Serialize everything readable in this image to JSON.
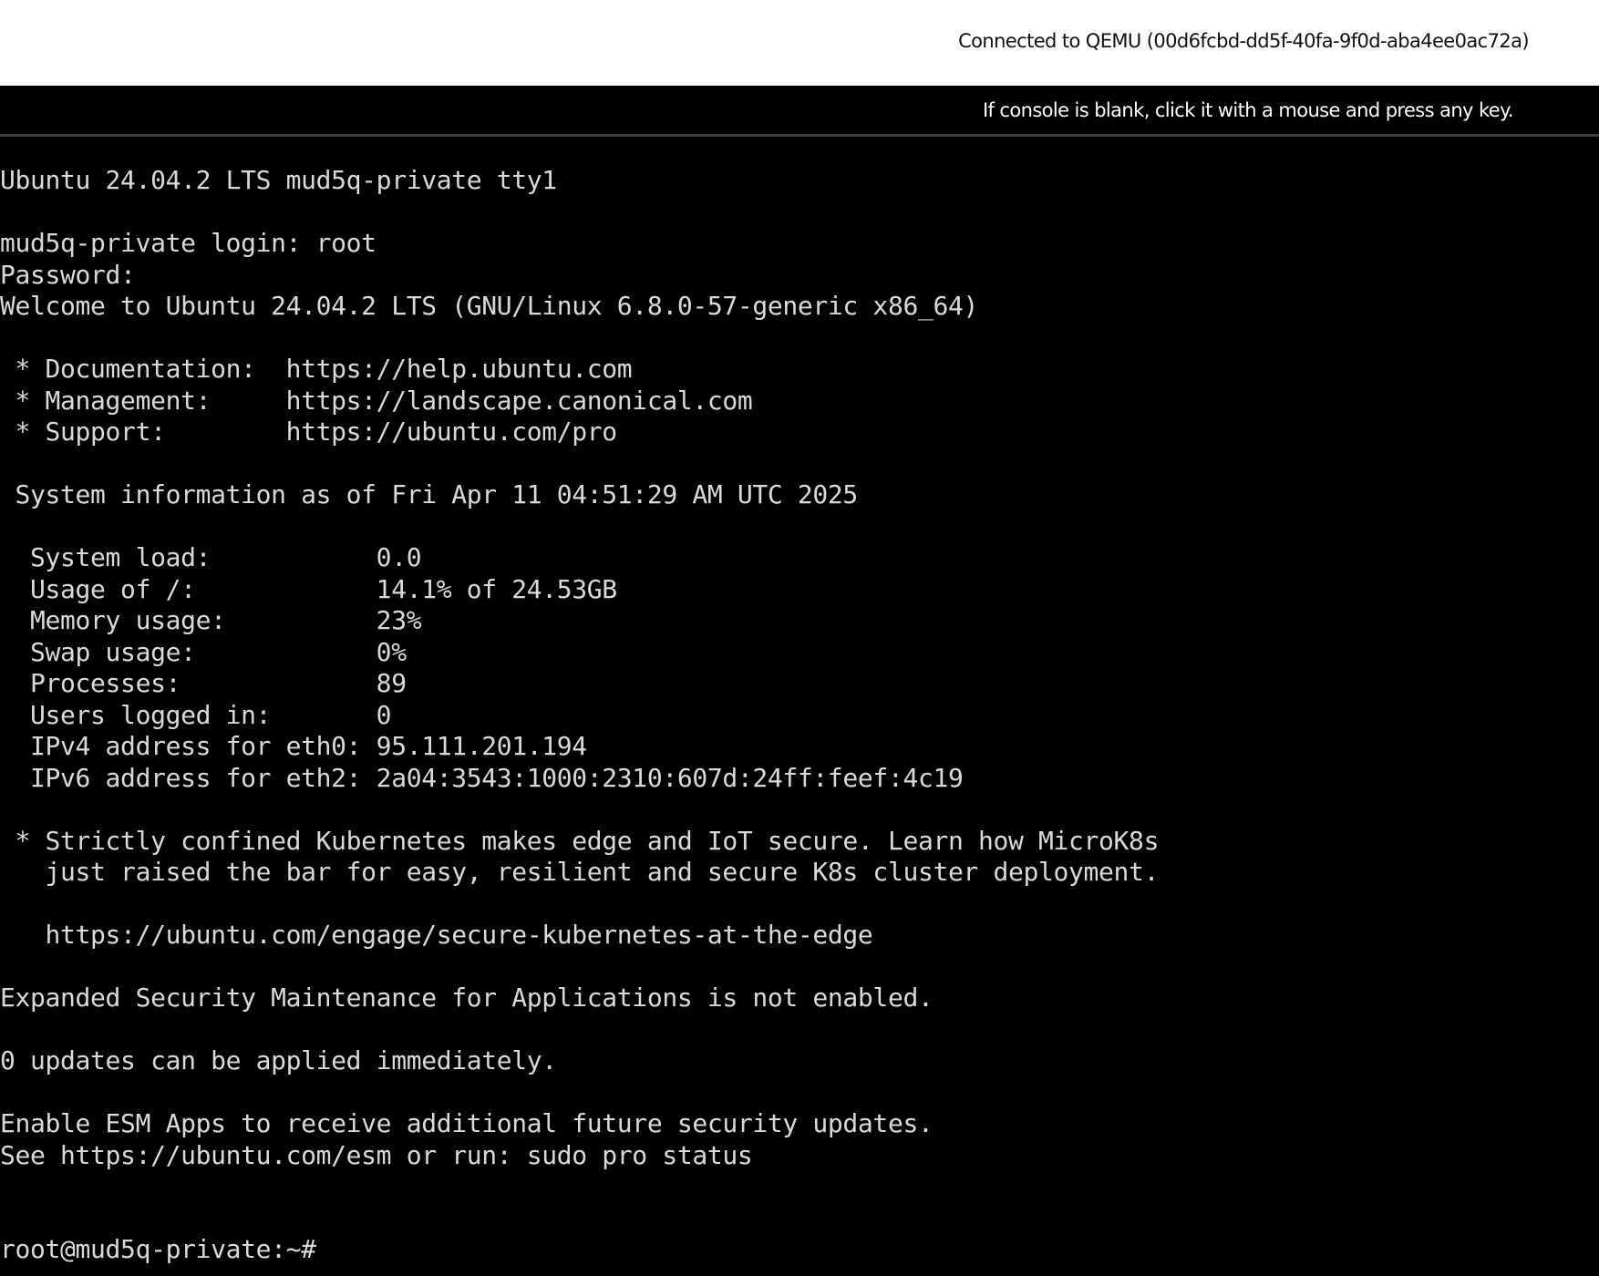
{
  "header": {
    "connection_status": "Connected to QEMU (00d6fcbd-dd5f-40fa-9f0d-aba4ee0ac72a)"
  },
  "console": {
    "hint": "If console is blank, click it with a mouse and press any key.",
    "lines": [
      "Ubuntu 24.04.2 LTS mud5q-private tty1",
      "",
      "mud5q-private login: root",
      "Password:",
      "Welcome to Ubuntu 24.04.2 LTS (GNU/Linux 6.8.0-57-generic x86_64)",
      "",
      " * Documentation:  https://help.ubuntu.com",
      " * Management:     https://landscape.canonical.com",
      " * Support:        https://ubuntu.com/pro",
      "",
      " System information as of Fri Apr 11 04:51:29 AM UTC 2025",
      "",
      "  System load:           0.0",
      "  Usage of /:            14.1% of 24.53GB",
      "  Memory usage:          23%",
      "  Swap usage:            0%",
      "  Processes:             89",
      "  Users logged in:       0",
      "  IPv4 address for eth0: 95.111.201.194",
      "  IPv6 address for eth2: 2a04:3543:1000:2310:607d:24ff:feef:4c19",
      "",
      " * Strictly confined Kubernetes makes edge and IoT secure. Learn how MicroK8s",
      "   just raised the bar for easy, resilient and secure K8s cluster deployment.",
      "",
      "   https://ubuntu.com/engage/secure-kubernetes-at-the-edge",
      "",
      "Expanded Security Maintenance for Applications is not enabled.",
      "",
      "0 updates can be applied immediately.",
      "",
      "Enable ESM Apps to receive additional future security updates.",
      "See https://ubuntu.com/esm or run: sudo pro status",
      "",
      "",
      "root@mud5q-private:~#"
    ]
  }
}
